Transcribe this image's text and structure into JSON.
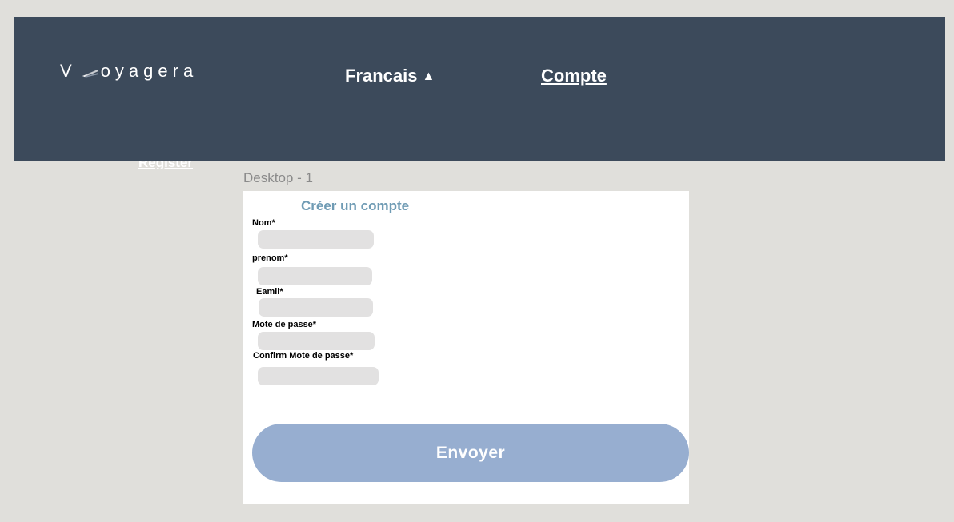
{
  "navbar": {
    "logo_prefix": "V",
    "logo_suffix": "oyagera",
    "language_label": "Francais",
    "language_caret": "▲",
    "account_label": "Compte",
    "background_color": "#3c4a5b"
  },
  "register_label": "Register",
  "frame_label": "Desktop - 1",
  "form": {
    "title": "Créer un compte",
    "fields": [
      {
        "label": "Nom*",
        "value": "",
        "placeholder": ""
      },
      {
        "label": "prenom*",
        "value": "",
        "placeholder": ""
      },
      {
        "label": "Eamil*",
        "value": "",
        "placeholder": ""
      },
      {
        "label": "Mote de passe*",
        "value": "",
        "placeholder": ""
      },
      {
        "label": "Confirm Mote de passe*",
        "value": "",
        "placeholder": ""
      }
    ],
    "submit_label": "Envoyer",
    "title_color": "#6f9bb4",
    "submit_color": "#97aed0"
  }
}
